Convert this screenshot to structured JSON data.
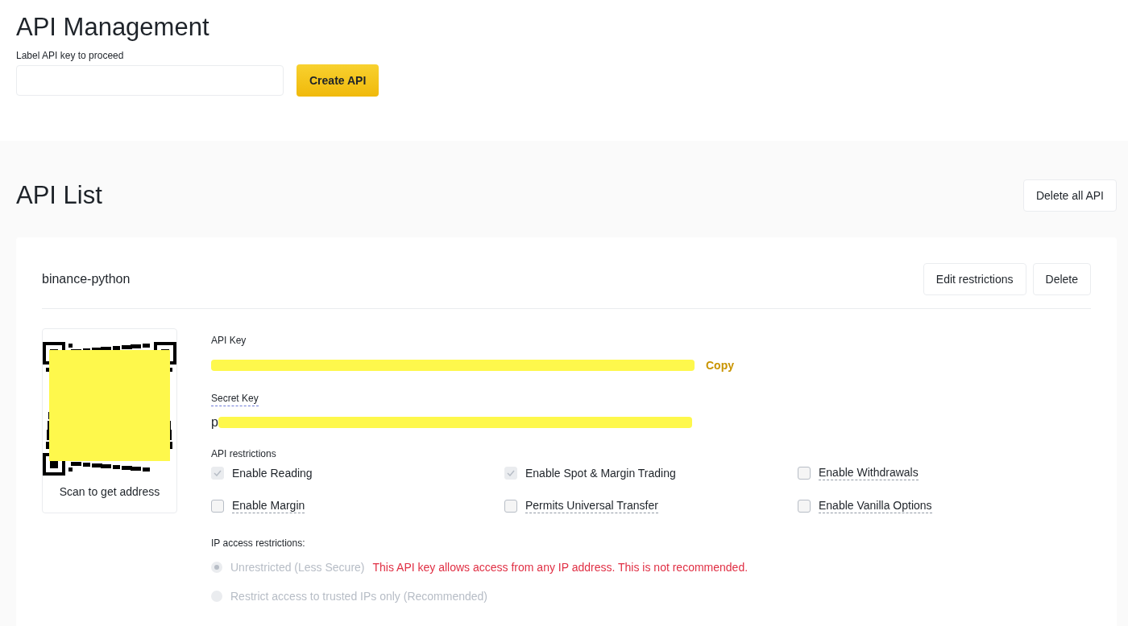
{
  "header": {
    "title": "API Management",
    "field_label": "Label API key to proceed",
    "create_button": "Create API"
  },
  "list": {
    "title": "API List",
    "delete_all_button": "Delete all API"
  },
  "card": {
    "name": "binance-python",
    "buttons": [
      "Edit restrictions",
      "Delete"
    ],
    "qr_caption": "Scan to get address",
    "api_key_label": "API Key",
    "copy_link": "Copy",
    "secret_key_label": "Secret Key",
    "secret_key_visible": "p",
    "restrictions_label": "API restrictions",
    "restrictions": [
      {
        "label": "Enable Reading",
        "checked": true,
        "disabled": true,
        "underlined": false
      },
      {
        "label": "Enable Spot & Margin Trading",
        "checked": true,
        "disabled": true,
        "underlined": false
      },
      {
        "label": "Enable Withdrawals",
        "checked": false,
        "disabled": false,
        "underlined": true
      },
      {
        "label": "Enable Margin",
        "checked": false,
        "disabled": false,
        "underlined": true
      },
      {
        "label": "Permits Universal Transfer",
        "checked": false,
        "disabled": false,
        "underlined": true
      },
      {
        "label": "Enable Vanilla Options",
        "checked": false,
        "disabled": false,
        "underlined": true
      }
    ],
    "ip_label": "IP access restrictions:",
    "ip_options": [
      {
        "label": "Unrestricted (Less Secure)",
        "selected": true,
        "disabled": true,
        "warning": "This API key allows access from any IP address. This is not recommended."
      },
      {
        "label": "Restrict access to trusted IPs only (Recommended)",
        "selected": false,
        "disabled": true
      }
    ]
  }
}
